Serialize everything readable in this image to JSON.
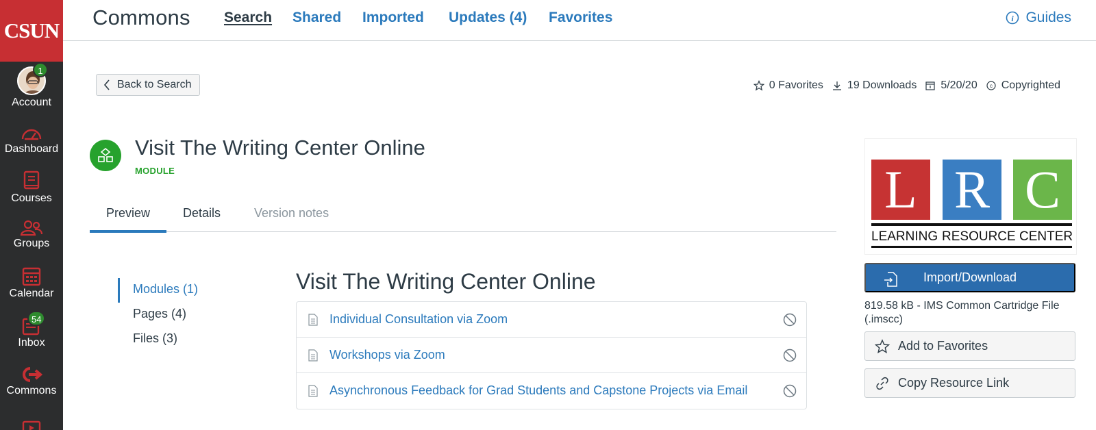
{
  "global_nav": {
    "logo": "CSUN",
    "items": [
      {
        "label": "Account",
        "badge": "1"
      },
      {
        "label": "Dashboard"
      },
      {
        "label": "Courses"
      },
      {
        "label": "Groups"
      },
      {
        "label": "Calendar"
      },
      {
        "label": "Inbox",
        "badge": "54"
      },
      {
        "label": "Commons"
      }
    ],
    "accent_color": "#c72f33"
  },
  "topbar": {
    "title": "Commons",
    "links": [
      "Search",
      "Shared",
      "Imported",
      "Updates (4)",
      "Favorites"
    ],
    "active_link": "Search",
    "guides": "Guides"
  },
  "header": {
    "back_label": "Back to Search",
    "favorites": "0 Favorites",
    "downloads": "19 Downloads",
    "date": "5/20/20",
    "license": "Copyrighted"
  },
  "resource": {
    "title": "Visit The Writing Center Online",
    "type": "MODULE",
    "type_color": "#27a22d"
  },
  "tabs": [
    {
      "label": "Preview",
      "active": true
    },
    {
      "label": "Details"
    },
    {
      "label": "Version notes",
      "disabled": true
    }
  ],
  "preview": {
    "menu": [
      "Modules (1)",
      "Pages (4)",
      "Files (3)"
    ],
    "active_menu": "Modules (1)",
    "module_title": "Visit The Writing Center Online",
    "items": [
      "Individual Consultation via Zoom",
      "Workshops via Zoom",
      "Asynchronous Feedback for Grad Students and Capstone Projects via Email"
    ]
  },
  "sidebar": {
    "thumbnail": {
      "letters": [
        "L",
        "R",
        "C"
      ],
      "colors": [
        "#c63333",
        "#3a7ec2",
        "#6bb64a"
      ],
      "words": [
        "LEARNING",
        "RESOURCE",
        "CENTER"
      ]
    },
    "import_label": "Import/Download",
    "file_info": "819.58 kB - IMS Common Cartridge File (.imscc)",
    "favorite_label": "Add to Favorites",
    "copy_label": "Copy Resource Link"
  }
}
